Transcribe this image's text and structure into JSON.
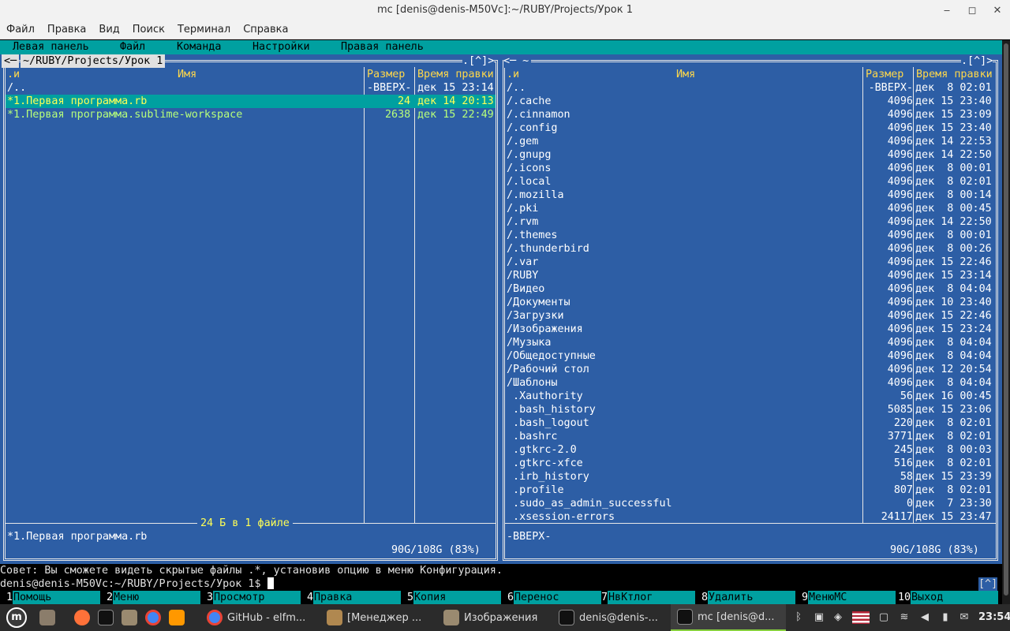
{
  "window": {
    "title": "mc [denis@denis-M50Vc]:~/RUBY/Projects/Урок 1",
    "minimize": "‒",
    "maximize": "◻",
    "close": "✕"
  },
  "menubar": [
    "Файл",
    "Правка",
    "Вид",
    "Поиск",
    "Терминал",
    "Справка"
  ],
  "mc_menu": [
    "Левая панель",
    "Файл",
    "Команда",
    "Настройки",
    "Правая панель"
  ],
  "left_panel": {
    "top_left": "<─",
    "path": "~/RUBY/Projects/Урок 1",
    "top_right": ".[^]>",
    "col_sort": ".и",
    "col_name": "Имя",
    "col_size": "Размер",
    "col_time": "Время правки",
    "rows": [
      {
        "name": "/..",
        "size": "-ВВЕРХ-",
        "time": "дек 15 23:14"
      },
      {
        "name": "*1.Первая программа.rb",
        "size": "24",
        "time": "дек 14 20:13"
      },
      {
        "name": "*1.Первая программа.sublime-workspace",
        "size": "2638",
        "time": "дек 15 22:49"
      }
    ],
    "summary": "24 Б в 1 файле",
    "status": "*1.Первая программа.rb",
    "disk": "90G/108G (83%)"
  },
  "right_panel": {
    "top_left": "<─ ~",
    "top_right": ".[^]>",
    "col_sort": ".и",
    "col_name": "Имя",
    "col_size": "Размер",
    "col_time": "Время правки",
    "rows": [
      {
        "name": "/..",
        "size": "-ВВЕРХ-",
        "time": "дек  8 02:01"
      },
      {
        "name": "/.cache",
        "size": "4096",
        "time": "дек 15 23:40"
      },
      {
        "name": "/.cinnamon",
        "size": "4096",
        "time": "дек 15 23:09"
      },
      {
        "name": "/.config",
        "size": "4096",
        "time": "дек 15 23:40"
      },
      {
        "name": "/.gem",
        "size": "4096",
        "time": "дек 14 22:53"
      },
      {
        "name": "/.gnupg",
        "size": "4096",
        "time": "дек 14 22:50"
      },
      {
        "name": "/.icons",
        "size": "4096",
        "time": "дек  8 00:01"
      },
      {
        "name": "/.local",
        "size": "4096",
        "time": "дек  8 02:01"
      },
      {
        "name": "/.mozilla",
        "size": "4096",
        "time": "дек  8 00:14"
      },
      {
        "name": "/.pki",
        "size": "4096",
        "time": "дек  8 00:45"
      },
      {
        "name": "/.rvm",
        "size": "4096",
        "time": "дек 14 22:50"
      },
      {
        "name": "/.themes",
        "size": "4096",
        "time": "дек  8 00:01"
      },
      {
        "name": "/.thunderbird",
        "size": "4096",
        "time": "дек  8 00:26"
      },
      {
        "name": "/.var",
        "size": "4096",
        "time": "дек 15 22:46"
      },
      {
        "name": "/RUBY",
        "size": "4096",
        "time": "дек 15 23:14"
      },
      {
        "name": "/Видео",
        "size": "4096",
        "time": "дек  8 04:04"
      },
      {
        "name": "/Документы",
        "size": "4096",
        "time": "дек 10 23:40"
      },
      {
        "name": "/Загрузки",
        "size": "4096",
        "time": "дек 15 22:46"
      },
      {
        "name": "/Изображения",
        "size": "4096",
        "time": "дек 15 23:24"
      },
      {
        "name": "/Музыка",
        "size": "4096",
        "time": "дек  8 04:04"
      },
      {
        "name": "/Общедоступные",
        "size": "4096",
        "time": "дек  8 04:04"
      },
      {
        "name": "/Рабочий стол",
        "size": "4096",
        "time": "дек 12 20:54"
      },
      {
        "name": "/Шаблоны",
        "size": "4096",
        "time": "дек  8 04:04"
      },
      {
        "name": " .Xauthority",
        "size": "56",
        "time": "дек 16 00:45"
      },
      {
        "name": " .bash_history",
        "size": "5085",
        "time": "дек 15 23:06"
      },
      {
        "name": " .bash_logout",
        "size": "220",
        "time": "дек  8 02:01"
      },
      {
        "name": " .bashrc",
        "size": "3771",
        "time": "дек  8 02:01"
      },
      {
        "name": " .gtkrc-2.0",
        "size": "245",
        "time": "дек  8 00:03"
      },
      {
        "name": " .gtkrc-xfce",
        "size": "516",
        "time": "дек  8 02:01"
      },
      {
        "name": " .irb_history",
        "size": "58",
        "time": "дек 15 23:39"
      },
      {
        "name": " .profile",
        "size": "807",
        "time": "дек  8 02:01"
      },
      {
        "name": " .sudo_as_admin_successful",
        "size": "0",
        "time": "дек  7 23:30"
      },
      {
        "name": " .xsession-errors",
        "size": "24117",
        "time": "дек 15 23:47"
      }
    ],
    "status": "-ВВЕРХ-",
    "disk": "90G/108G (83%)"
  },
  "hint": "Совет: Вы сможете видеть скрытые файлы .*, установив опцию в меню Конфигурация.",
  "prompt": "denis@denis-M50Vc:~/RUBY/Projects/Урок 1$ ",
  "prompt_right": "[^]",
  "fkeys": [
    {
      "n": "1",
      "label": "Помощь"
    },
    {
      "n": "2",
      "label": "Меню"
    },
    {
      "n": "3",
      "label": "Просмотр"
    },
    {
      "n": "4",
      "label": "Правка"
    },
    {
      "n": "5",
      "label": "Копия"
    },
    {
      "n": "6",
      "label": "Перенос"
    },
    {
      "n": "7",
      "label": "НвКтлог"
    },
    {
      "n": "8",
      "label": "Удалить"
    },
    {
      "n": "9",
      "label": "МенюМС"
    },
    {
      "n": "10",
      "label": "Выход"
    }
  ],
  "taskbar": {
    "windows": [
      "GitHub - elfm...",
      "[Менеджер ...",
      "Изображения",
      "denis@denis-...",
      "mc [denis@d..."
    ],
    "clock": "23:54",
    "colors": {
      "mint": "#87cf3e",
      "firefox": "#ff7139",
      "chrome": "#4285f4",
      "sublime": "#ff9800",
      "active": "#3d3d3d"
    }
  }
}
